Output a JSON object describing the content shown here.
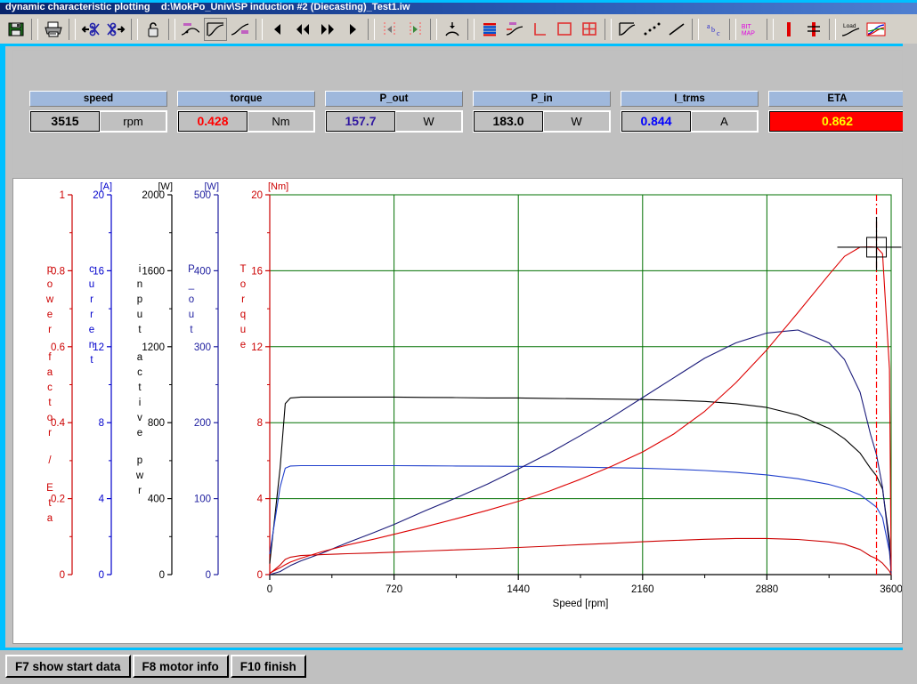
{
  "window": {
    "title_app": "dynamic characteristic plotting",
    "title_file": "d:\\MokPo_Univ\\SP induction #2 (Diecasting)_Test1.iw"
  },
  "toolbar": {
    "buttons": [
      {
        "name": "save-button",
        "icon": "floppy-disk-icon",
        "tip": "Save"
      },
      {
        "name": "print-button",
        "icon": "printer-icon",
        "tip": "Print"
      },
      {
        "name": "cut-left-button",
        "icon": "scissors-left-icon",
        "tip": "Cut left"
      },
      {
        "name": "cut-right-button",
        "icon": "scissors-right-icon",
        "tip": "Cut right"
      },
      {
        "name": "lock-button",
        "icon": "padlock-icon",
        "tip": "Lock"
      },
      {
        "name": "marker-curve-button",
        "icon": "curve-marker-icon",
        "tip": "Marker curve"
      },
      {
        "name": "curve-frame-button",
        "icon": "curve-frame-icon",
        "tip": "Curve frame"
      },
      {
        "name": "curve-label-button",
        "icon": "curve-label-icon",
        "tip": "Curve label"
      },
      {
        "name": "step-back-button",
        "icon": "triangle-left-icon",
        "tip": "Step back"
      },
      {
        "name": "fast-back-button",
        "icon": "double-triangle-left-icon",
        "tip": "Fast back"
      },
      {
        "name": "fast-forward-button",
        "icon": "double-triangle-right-icon",
        "tip": "Fast forward"
      },
      {
        "name": "step-forward-button",
        "icon": "triangle-right-icon",
        "tip": "Step forward"
      },
      {
        "name": "cursor-left-button",
        "icon": "cursor-left-icon",
        "tip": "Cursor left"
      },
      {
        "name": "cursor-right-button",
        "icon": "cursor-right-icon",
        "tip": "Cursor right"
      },
      {
        "name": "snap-point-button",
        "icon": "snap-point-icon",
        "tip": "Snap to point"
      },
      {
        "name": "legend-button",
        "icon": "legend-bars-icon",
        "tip": "Legend"
      },
      {
        "name": "axis-marker-button",
        "icon": "axis-marker-icon",
        "tip": "Axis marker"
      },
      {
        "name": "axes-corner-button",
        "icon": "axes-corner-icon",
        "tip": "Axes"
      },
      {
        "name": "plot-box-button",
        "icon": "plot-box-icon",
        "tip": "Plot box"
      },
      {
        "name": "grid-button",
        "icon": "grid-icon",
        "tip": "Grid"
      },
      {
        "name": "line-style-button",
        "icon": "line-curve-icon",
        "tip": "Line style"
      },
      {
        "name": "dotted-line-button",
        "icon": "dotted-line-icon",
        "tip": "Dotted line"
      },
      {
        "name": "straight-line-button",
        "icon": "straight-line-icon",
        "tip": "Straight line"
      },
      {
        "name": "text-abc-button",
        "icon": "abc-text-icon",
        "tip": "Text"
      },
      {
        "name": "bitmap-button",
        "icon": "bitmap-icon",
        "tip": "BIT MAP"
      },
      {
        "name": "vertical-bar-button",
        "icon": "red-bar-icon",
        "tip": "Bar"
      },
      {
        "name": "vertical-bar-marker-button",
        "icon": "red-bar-marker-icon",
        "tip": "Bar marker"
      },
      {
        "name": "load-curve-button",
        "icon": "load-curve-icon",
        "tip": "Load"
      },
      {
        "name": "plot-preview-button",
        "icon": "plot-preview-icon",
        "tip": "Preview"
      }
    ]
  },
  "readouts": [
    {
      "name": "speed",
      "label": "speed",
      "value": "3515",
      "unit": "rpm",
      "color": "#000000",
      "highlight": false
    },
    {
      "name": "torque",
      "label": "torque",
      "value": "0.428",
      "unit": "Nm",
      "color": "#ff0000",
      "highlight": false
    },
    {
      "name": "p-out",
      "label": "P_out",
      "value": "157.7",
      "unit": "W",
      "color": "#3018a0",
      "highlight": false
    },
    {
      "name": "p-in",
      "label": "P_in",
      "value": "183.0",
      "unit": "W",
      "color": "#000000",
      "highlight": false
    },
    {
      "name": "i-trms",
      "label": "I_trms",
      "value": "0.844",
      "unit": "A",
      "color": "#0000ff",
      "highlight": false
    },
    {
      "name": "eta",
      "label": "ETA",
      "value": "0.862",
      "unit": "",
      "color": "#ffff00",
      "highlight": true
    }
  ],
  "footer": {
    "buttons": [
      {
        "name": "f7-show-start-data",
        "label": "F7 show start data"
      },
      {
        "name": "f8-motor-info",
        "label": "F8 motor info"
      },
      {
        "name": "f10-finish",
        "label": "F10 finish"
      }
    ]
  },
  "chart_data": {
    "type": "line",
    "title": "",
    "xlabel": "Speed [rpm]",
    "xlim": [
      0,
      3600
    ],
    "xticks": [
      0,
      720,
      1440,
      2160,
      2880,
      3600
    ],
    "grid": true,
    "grid_color": "#007000",
    "legend": "none",
    "cursor": {
      "x": 3515,
      "label": "cursor-crosshair",
      "color": "#ff0000",
      "style": "dash-dot"
    },
    "axes": [
      {
        "name": "power-factor-eta-axis",
        "label": "power factor / Eta",
        "unit": "",
        "color": "#cc0000",
        "min": 0,
        "max": 1,
        "ticks": [
          "0",
          "0.2",
          "0.4",
          "0.6",
          "0.8",
          "1"
        ]
      },
      {
        "name": "current-axis",
        "label": "current",
        "unit": "[A]",
        "color": "#0000cc",
        "min": 0,
        "max": 20,
        "ticks": [
          "0",
          "4",
          "8",
          "12",
          "16",
          "20"
        ]
      },
      {
        "name": "input-active-power-axis",
        "label": "input active pwr",
        "unit": "[W]",
        "color": "#000000",
        "min": 0,
        "max": 2000,
        "ticks": [
          "0",
          "400",
          "800",
          "1200",
          "1600",
          "2000"
        ]
      },
      {
        "name": "p-out-axis",
        "label": "P_out",
        "unit": "[W]",
        "color": "#2020a0",
        "min": 0,
        "max": 500,
        "ticks": [
          "0",
          "100",
          "200",
          "300",
          "400",
          "500"
        ]
      },
      {
        "name": "torque-axis",
        "label": "Torque",
        "unit": "[Nm]",
        "color": "#cc0000",
        "min": 0,
        "max": 20,
        "ticks": [
          "0",
          "4",
          "8",
          "12",
          "16",
          "20"
        ]
      }
    ],
    "x": [
      0,
      60,
      90,
      120,
      180,
      300,
      450,
      600,
      720,
      900,
      1080,
      1260,
      1440,
      1620,
      1800,
      1980,
      2160,
      2340,
      2520,
      2700,
      2880,
      3060,
      3240,
      3330,
      3420,
      3480,
      3515,
      3550,
      3590,
      3600
    ],
    "series": [
      {
        "name": "input-active-pwr",
        "axis": "input-active-power-axis",
        "color": "#000000",
        "unit": "W",
        "values": [
          60,
          560,
          900,
          930,
          935,
          935,
          935,
          935,
          935,
          933,
          932,
          930,
          930,
          928,
          926,
          924,
          922,
          918,
          912,
          900,
          880,
          840,
          770,
          715,
          640,
          560,
          520,
          450,
          180,
          0
        ]
      },
      {
        "name": "current",
        "axis": "current-axis",
        "color": "#2040cc",
        "unit": "A",
        "values": [
          1.1,
          4.6,
          5.6,
          5.72,
          5.74,
          5.74,
          5.74,
          5.74,
          5.74,
          5.73,
          5.72,
          5.71,
          5.7,
          5.68,
          5.66,
          5.63,
          5.6,
          5.55,
          5.48,
          5.38,
          5.25,
          5.05,
          4.75,
          4.52,
          4.2,
          3.8,
          3.55,
          3.0,
          1.2,
          0.25
        ]
      },
      {
        "name": "p-out",
        "axis": "p-out-axis",
        "color": "#1a1a7a",
        "unit": "W",
        "values": [
          0,
          4,
          8,
          12,
          18,
          28,
          42,
          55,
          66,
          84,
          101,
          119,
          139,
          160,
          183,
          207,
          233,
          259,
          285,
          305,
          318,
          322,
          305,
          283,
          240,
          185,
          158,
          115,
          35,
          0
        ]
      },
      {
        "name": "torque",
        "axis": "torque-axis",
        "color": "#cc0000",
        "unit": "Nm",
        "values": [
          0.05,
          0.5,
          0.8,
          0.92,
          1.0,
          1.05,
          1.1,
          1.14,
          1.18,
          1.24,
          1.3,
          1.36,
          1.43,
          1.5,
          1.58,
          1.65,
          1.73,
          1.8,
          1.86,
          1.9,
          1.9,
          1.85,
          1.72,
          1.6,
          1.32,
          0.98,
          0.84,
          0.6,
          0.18,
          0.0
        ]
      },
      {
        "name": "power-factor-eta",
        "axis": "power-factor-eta-axis",
        "color": "#dd0000",
        "unit": "",
        "values": [
          0.004,
          0.018,
          0.026,
          0.033,
          0.043,
          0.06,
          0.078,
          0.093,
          0.106,
          0.126,
          0.147,
          0.169,
          0.193,
          0.22,
          0.251,
          0.285,
          0.323,
          0.37,
          0.43,
          0.505,
          0.592,
          0.69,
          0.79,
          0.838,
          0.862,
          0.863,
          0.862,
          0.845,
          0.54,
          0.01
        ]
      }
    ]
  }
}
